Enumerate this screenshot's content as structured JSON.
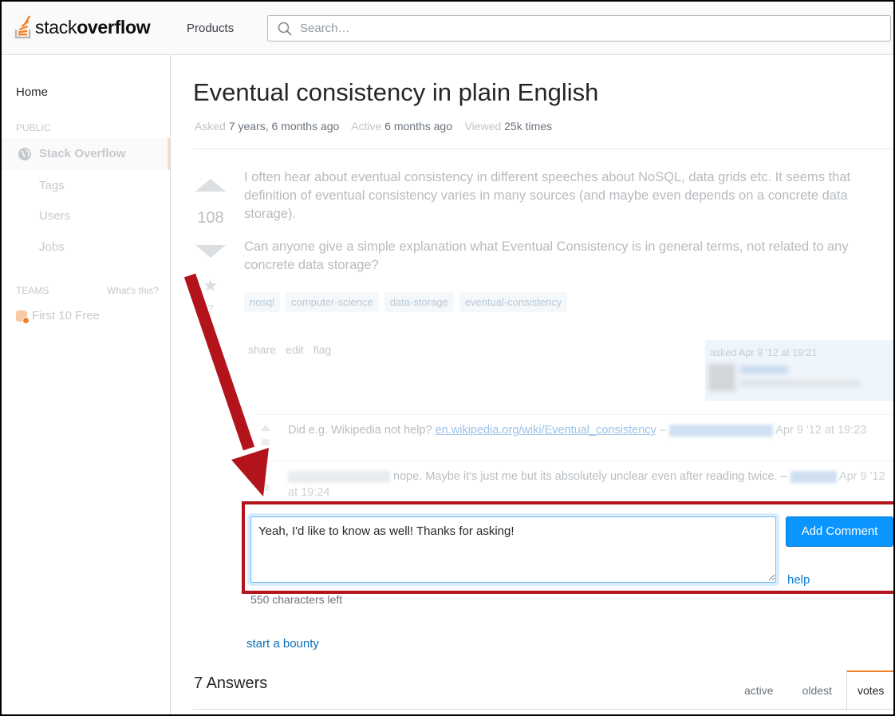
{
  "header": {
    "logo_text_light": "stack",
    "logo_text_bold": "overflow",
    "products_label": "Products",
    "search_placeholder": "Search…"
  },
  "sidebar": {
    "home": "Home",
    "public_heading": "PUBLIC",
    "stack_overflow": "Stack Overflow",
    "items": [
      "Tags",
      "Users",
      "Jobs"
    ],
    "teams_heading": "TEAMS",
    "whats_this": "What's this?",
    "first_free": "First 10 Free"
  },
  "question": {
    "title": "Eventual consistency in plain English",
    "asked_label": "Asked",
    "asked_value": "7 years, 6 months ago",
    "active_label": "Active",
    "active_value": "6 months ago",
    "viewed_label": "Viewed",
    "viewed_value": "25k times",
    "votes": "108",
    "favorites": "7",
    "body": [
      "I often hear about eventual consistency in different speeches about NoSQL, data grids etc. It seems that definition of eventual consistency varies in many sources (and maybe even depends on a concrete data storage).",
      "Can anyone give a simple explanation what Eventual Consistency is in general terms, not related to any concrete data storage?"
    ],
    "tags": [
      "nosql",
      "computer-science",
      "data-storage",
      "eventual-consistency"
    ],
    "menu": [
      "share",
      "edit",
      "flag"
    ],
    "asked_stamp": "asked Apr 9 '12 at 19:21"
  },
  "comments": [
    {
      "text_before": "Did e.g. Wikipedia not help?",
      "link": "en.wikipedia.org/wiki/Eventual_consistency",
      "dash": "–",
      "date": "Apr 9 '12 at 19:23"
    },
    {
      "text": "nope. Maybe it's just me but its absolutely unclear even after reading twice. –",
      "date": "Apr 9 '12 at 19:24"
    }
  ],
  "comment_form": {
    "value": "Yeah, I'd like to know as well! Thanks for asking!",
    "add_button": "Add Comment",
    "help": "help",
    "chars_left": "550 characters left"
  },
  "start_bounty": "start a bounty",
  "answers": {
    "title": "7 Answers",
    "sort_tabs": [
      "active",
      "oldest",
      "votes"
    ],
    "active_tab": "votes"
  },
  "colors": {
    "brand_orange": "#f48024",
    "button_blue": "#0a95ff",
    "annotation_red": "#b3141b"
  }
}
